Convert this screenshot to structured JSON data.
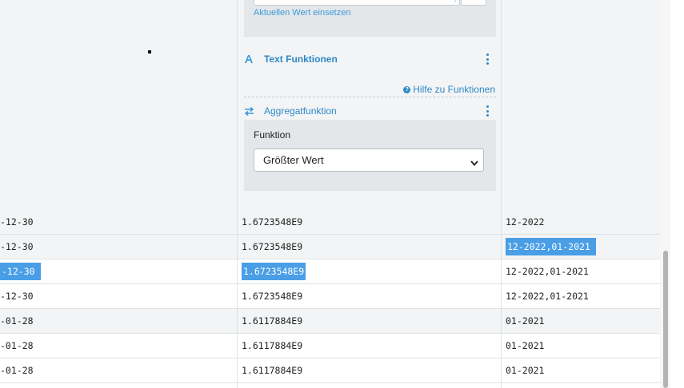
{
  "config": {
    "current_value_link": "Aktuellen Wert einsetzen",
    "text_functions": {
      "icon": "letter-a-icon",
      "title": "Text Funktionen"
    },
    "help_link": "Hilfe zu Funktionen",
    "aggregate": {
      "icon": "swap-arrows-icon",
      "title": "Aggregatfunktion"
    },
    "function_label": "Funktion",
    "function_select": {
      "value": "Größter Wert"
    }
  },
  "table": {
    "rows": [
      {
        "c1": "-12-30",
        "c2": "1.6723548E9",
        "c3": "12-2022",
        "grey": true,
        "sel1": false,
        "sel2": false,
        "sel3": false
      },
      {
        "c1": "-12-30",
        "c2": "1.6723548E9",
        "c3": "12-2022,01-2021",
        "grey": true,
        "sel1": false,
        "sel2": false,
        "sel3": true
      },
      {
        "c1": "-12-30",
        "c2": "1.6723548E9",
        "c3": "12-2022,01-2021",
        "grey": false,
        "sel1": true,
        "sel2": true,
        "sel3": false
      },
      {
        "c1": "-12-30",
        "c2": "1.6723548E9",
        "c3": "12-2022,01-2021",
        "grey": false,
        "sel1": false,
        "sel2": false,
        "sel3": false
      },
      {
        "c1": "-01-28",
        "c2": "1.6117884E9",
        "c3": "01-2021",
        "grey": true,
        "sel1": false,
        "sel2": false,
        "sel3": false
      },
      {
        "c1": "-01-28",
        "c2": "1.6117884E9",
        "c3": "01-2021",
        "grey": false,
        "sel1": false,
        "sel2": false,
        "sel3": false
      },
      {
        "c1": "-01-28",
        "c2": "1.6117884E9",
        "c3": "01-2021",
        "grey": false,
        "sel1": false,
        "sel2": false,
        "sel3": false
      }
    ]
  },
  "colors": {
    "accent": "#2f88c7",
    "selection": "#4a9ee6",
    "panel_bg": "#e4e7e9",
    "area_bg": "#f2f4f5"
  }
}
